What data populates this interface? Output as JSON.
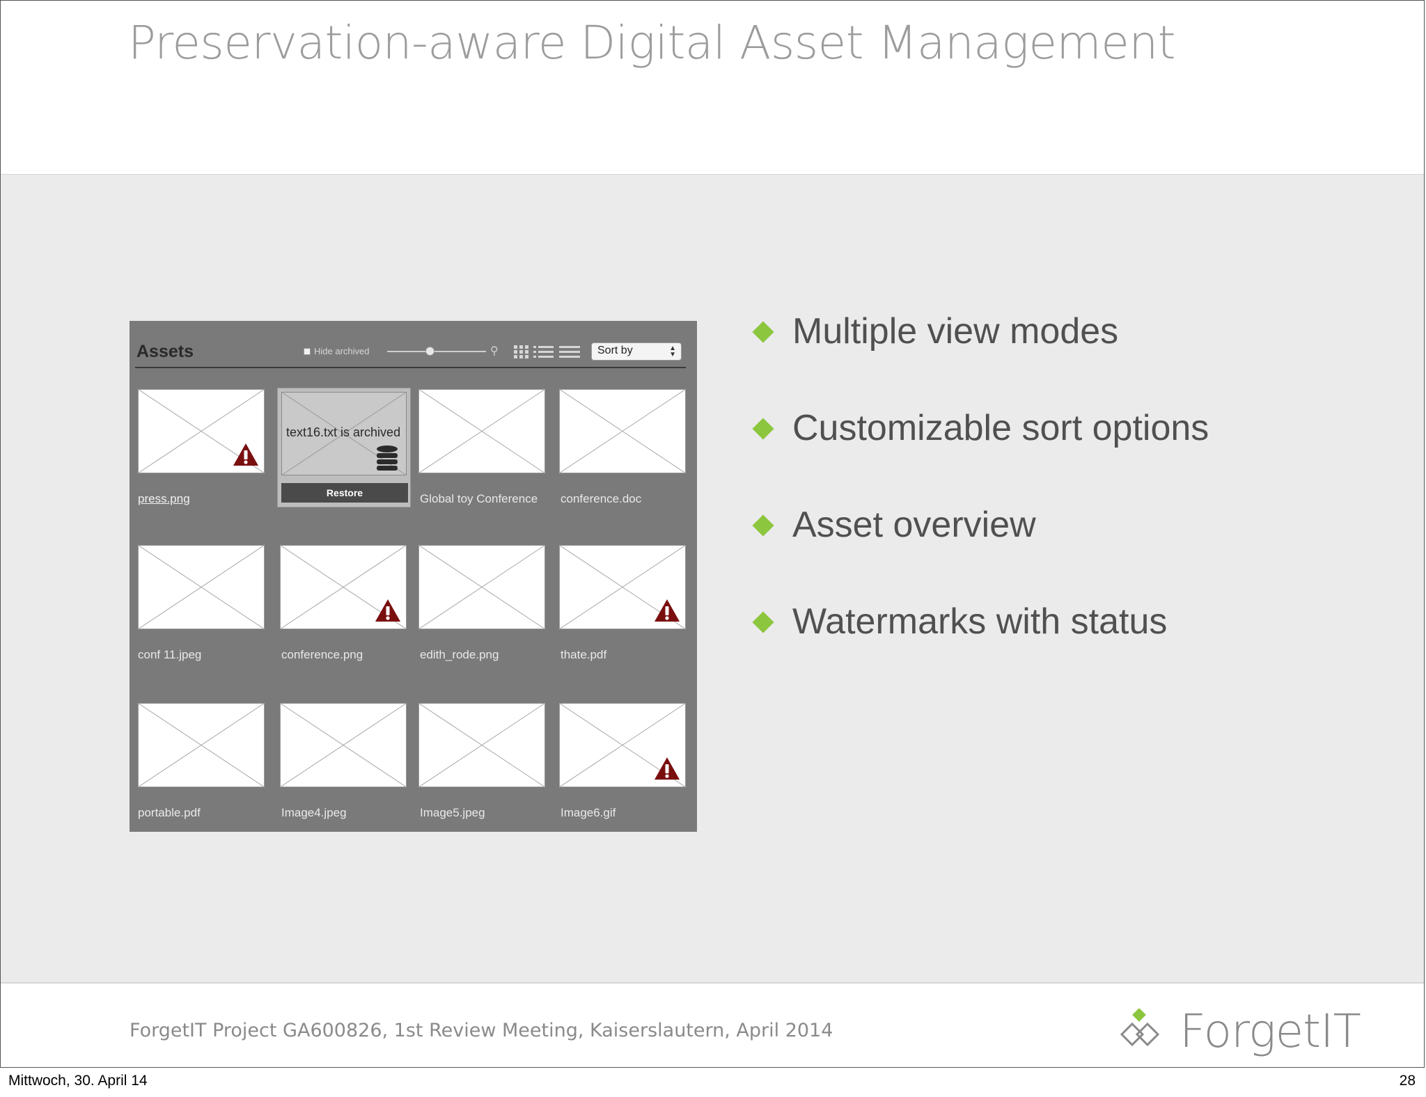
{
  "slide": {
    "title": "Preservation-aware Digital Asset Management",
    "footer": "ForgetIT Project GA600826, 1st Review Meeting, Kaiserslautern, April 2014",
    "logo_text": "ForgetIT",
    "accent_color": "#8cc63f"
  },
  "mockup": {
    "title": "Assets",
    "hide_archived_label": "Hide archived",
    "sort_label": "Sort by",
    "archived_message": "text16.txt is archived",
    "restore_label": "Restore",
    "tiles": [
      {
        "label": "press.png",
        "warning": true
      },
      {
        "label": "",
        "archived": true
      },
      {
        "label": "Global toy Conference",
        "warning": false
      },
      {
        "label": "conference.doc",
        "warning": false
      },
      {
        "label": "conf 11.jpeg",
        "warning": false
      },
      {
        "label": "conference.png",
        "warning": true
      },
      {
        "label": "edith_rode.png",
        "warning": false
      },
      {
        "label": "thate.pdf",
        "warning": true
      },
      {
        "label": "portable.pdf",
        "warning": false
      },
      {
        "label": "Image4.jpeg",
        "warning": false
      },
      {
        "label": "Image5.jpeg",
        "warning": false
      },
      {
        "label": "Image6.gif",
        "warning": true
      }
    ]
  },
  "bullets": [
    "Multiple view modes",
    "Customizable sort options",
    "Asset overview",
    "Watermarks with status"
  ],
  "page": {
    "date": "Mittwoch, 30. April 14",
    "number": "28"
  }
}
